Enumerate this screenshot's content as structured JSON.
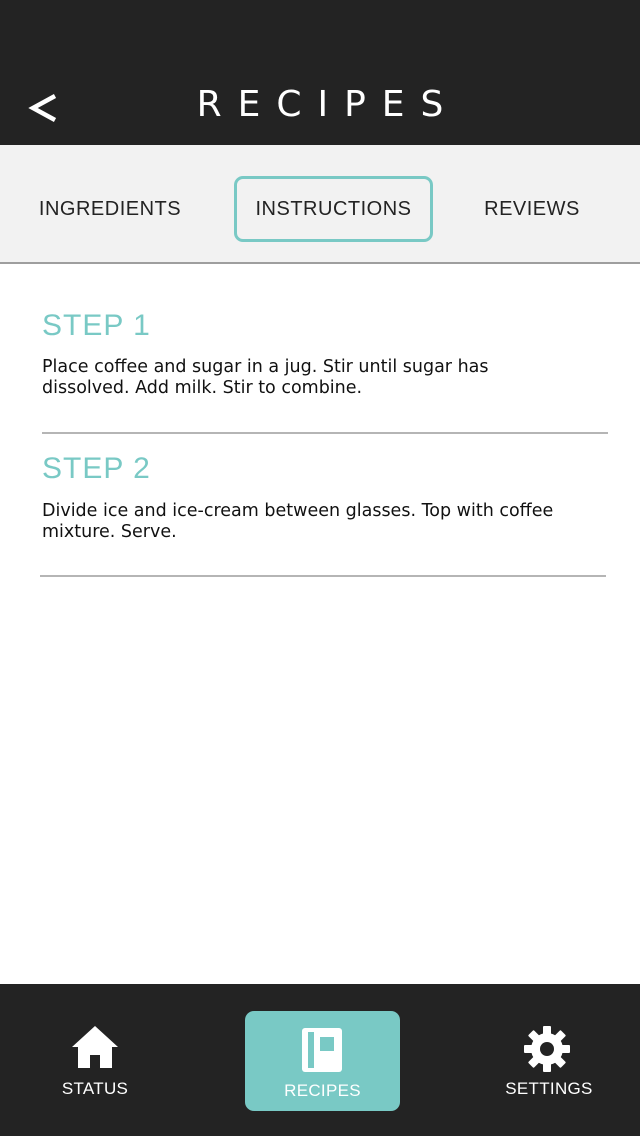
{
  "header": {
    "title": "RECIPES",
    "back_icon": "chevron-left-icon"
  },
  "tabs": [
    {
      "label": "INGREDIENTS",
      "active": false
    },
    {
      "label": "INSTRUCTIONS",
      "active": true
    },
    {
      "label": "REVIEWS",
      "active": false
    }
  ],
  "steps": [
    {
      "title": "STEP 1",
      "lines": [
        "Place coffee and sugar in a jug. Stir until sugar has",
        "dissolved. Add milk. Stir to combine."
      ]
    },
    {
      "title": "STEP 2",
      "lines": [
        "Divide ice and ice-cream between glasses. Top with coffee",
        "mixture. Serve."
      ]
    }
  ],
  "bottom_nav": [
    {
      "label": "STATUS",
      "icon": "home-icon",
      "active": false
    },
    {
      "label": "RECIPES",
      "icon": "book-icon",
      "active": true
    },
    {
      "label": "SETTINGS",
      "icon": "gear-icon",
      "active": false
    }
  ],
  "colors": {
    "accent": "#79c9c5",
    "header_bg": "#232323",
    "tabs_bg": "#f2f2f2"
  }
}
